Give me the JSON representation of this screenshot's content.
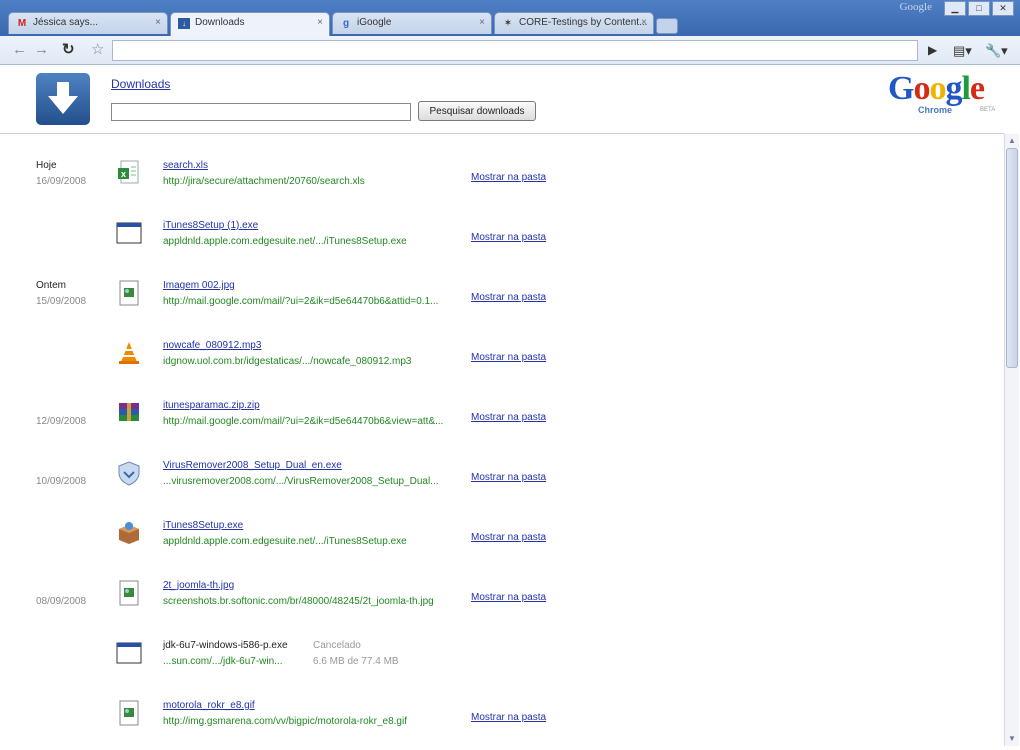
{
  "window": {
    "brand": "Google",
    "tabs": [
      {
        "title": "Jéssica says...",
        "icon": "gmail-icon"
      },
      {
        "title": "Downloads",
        "icon": "downloads-icon",
        "active": true
      },
      {
        "title": "iGoogle",
        "icon": "igoogle-icon"
      },
      {
        "title": "CORE-Testings by Content...",
        "icon": "core-icon"
      }
    ],
    "tab_close_glyph": "×"
  },
  "page": {
    "title": "Downloads",
    "search": {
      "value": "",
      "button_label": "Pesquisar downloads"
    },
    "logo": {
      "wordmark": "Google",
      "product": "Chrome",
      "badge": "BETA"
    },
    "groups": [
      {
        "label": "Hoje",
        "date": "16/09/2008"
      },
      {
        "label": "Ontem",
        "date": "15/09/2008"
      },
      {
        "label": "",
        "date": "12/09/2008"
      },
      {
        "label": "",
        "date": "10/09/2008"
      },
      {
        "label": "",
        "date": "08/09/2008"
      }
    ],
    "show_in_folder_label": "Mostrar na pasta",
    "downloads": [
      {
        "name": "search.xls",
        "url": "http://jira/secure/attachment/20760/search.xls",
        "icon": "excel-file-icon"
      },
      {
        "name": "iTunes8Setup (1).exe",
        "url": "appldnld.apple.com.edgesuite.net/.../iTunes8Setup.exe",
        "icon": "executable-window-icon"
      },
      {
        "name": "Imagem 002.jpg",
        "url": "http://mail.google.com/mail/?ui=2&ik=d5e64470b6&attid=0.1...",
        "icon": "image-file-icon"
      },
      {
        "name": "nowcafe_080912.mp3",
        "url": "idgnow.uol.com.br/idgestaticas/.../nowcafe_080912.mp3",
        "icon": "vlc-cone-icon"
      },
      {
        "name": "itunesparamac.zip.zip",
        "url": "http://mail.google.com/mail/?ui=2&ik=d5e64470b6&view=att&...",
        "icon": "winrar-archive-icon"
      },
      {
        "name": "VirusRemover2008_Setup_Dual_en.exe",
        "url": "...virusremover2008.com/.../VirusRemover2008_Setup_Dual...",
        "icon": "shield-installer-icon"
      },
      {
        "name": "iTunes8Setup.exe",
        "url": "appldnld.apple.com.edgesuite.net/.../iTunes8Setup.exe",
        "icon": "installer-box-icon"
      },
      {
        "name": "2t_joomla-th.jpg",
        "url": "screenshots.br.softonic.com/br/48000/48245/2t_joomla-th.jpg",
        "icon": "image-file-icon"
      },
      {
        "name": "jdk-6u7-windows-i586-p.exe",
        "url": "...sun.com/.../jdk-6u7-win...",
        "icon": "executable-window-icon",
        "status": "Cancelado",
        "progress": "6.6 MB de 77.4 MB"
      },
      {
        "name": "motorola_rokr_e8.gif",
        "url": "http://img.gsmarena.com/vv/bigpic/motorola-rokr_e8.gif",
        "icon": "image-file-icon"
      }
    ]
  },
  "colors": {
    "link": "#2233aa",
    "url_green": "#228822",
    "chrome_blue": "#3a68b0"
  }
}
